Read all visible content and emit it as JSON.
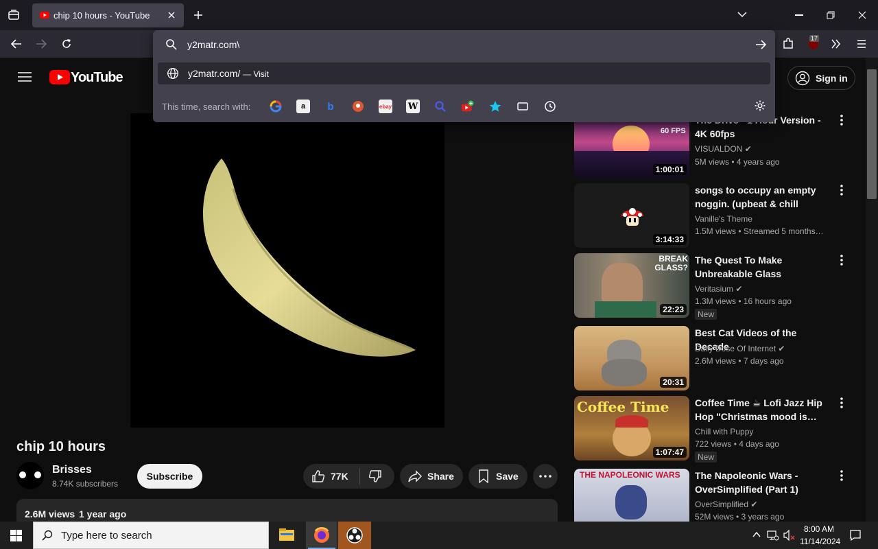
{
  "browser": {
    "tab_title": "chip 10 hours - YouTube",
    "url_value": "y2matr.com\\",
    "suggestion_text": "y2matr.com/",
    "suggestion_action": "— Visit",
    "search_with_label": "This time, search with:",
    "extension_badge": "17",
    "engines": [
      "google",
      "amazon",
      "bing",
      "duckduckgo",
      "ebay",
      "wikipedia",
      "search",
      "youtube",
      "bookmarks",
      "tabs",
      "history"
    ]
  },
  "youtube": {
    "logo_text": "YouTube",
    "sign_in": "Sign in",
    "video_title": "chip 10 hours",
    "channel": "Brisses",
    "subscribers": "8.74K subscribers",
    "subscribe": "Subscribe",
    "likes": "77K",
    "share": "Share",
    "save": "Save",
    "views": "2.6M views",
    "age": "1 year ago"
  },
  "recommendations": [
    {
      "title": "The Drive - 1 Hour Version - 4K 60fps",
      "channel": "VISUALDON",
      "verified": true,
      "meta": "5M views  • 4 years ago",
      "duration": "1:00:01",
      "badge": "",
      "thumb_text": "60 FPS"
    },
    {
      "title": "songs to occupy an empty noggin. (upbeat & chill video…",
      "channel": "Vanille's Theme",
      "verified": false,
      "meta": "1.5M views  • Streamed 5 months…",
      "duration": "3:14:33",
      "badge": "",
      "thumb_text": ""
    },
    {
      "title": "The Quest To Make Unbreakable Glass",
      "channel": "Veritasium",
      "verified": true,
      "meta": "1.3M views  • 16 hours ago",
      "duration": "22:23",
      "badge": "New",
      "thumb_text": "BREAK GLASS?"
    },
    {
      "title": "Best Cat Videos of the Decade",
      "channel": "Daily Dose Of Internet",
      "verified": true,
      "meta": "2.6M views  • 7 days ago",
      "duration": "20:31",
      "badge": "",
      "thumb_text": ""
    },
    {
      "title": "Coffee Time ☕ Lofi Jazz Hip Hop \"Christmas mood is…",
      "channel": "Chill with Puppy",
      "verified": false,
      "meta": "722 views  • 4 days ago",
      "duration": "1:07:47",
      "badge": "New",
      "thumb_text": "Coffee Time"
    },
    {
      "title": "The Napoleonic Wars - OverSimplified (Part 1)",
      "channel": "OverSimplified",
      "verified": true,
      "meta": "52M views  • 3 years ago",
      "duration": "",
      "badge": "",
      "thumb_text": "THE NAPOLEONIC WARS"
    }
  ],
  "taskbar": {
    "search_placeholder": "Type here to search",
    "time": "8:00 AM",
    "date": "11/14/2024"
  }
}
